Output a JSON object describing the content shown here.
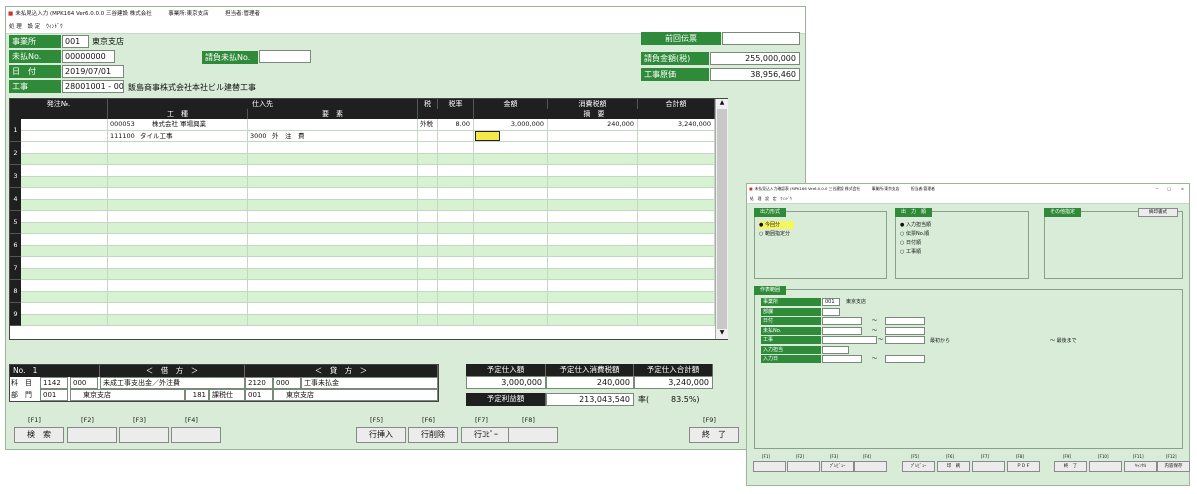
{
  "main": {
    "title": "未払見込入力 (MPK164 Ver6.0.0.0 三谷建設 株式会社　　　事業所:東京支店　　　担当者:管理者",
    "menu": [
      "処",
      "理",
      "設",
      "定",
      "ｳｨﾝﾄﾞｳ"
    ],
    "fields": {
      "jigyosho_label": "事業所",
      "jigyosho_code": "001",
      "jigyosho_name": "東京支店",
      "miharai_label": "未払No.",
      "miharai_value": "00000000",
      "date_label": "日　付",
      "date_value": "2019/07/01",
      "koji_label": "工事",
      "koji_code": "28001001 - 00",
      "koji_name": "飯島商事株式会社本社ビル建替工事",
      "ukeoi_label": "請負未払No.",
      "ukeoi_value": "",
      "zenkai_label": "前回伝票",
      "zenkai_value": "",
      "seiou_label": "請負金額(税)",
      "seiou_value": "255,000,000",
      "genka_label": "工事原価",
      "genka_value": "38,956,460"
    },
    "grid": {
      "head1": [
        "発注№.",
        "仕入先",
        "税",
        "税率",
        "金額",
        "消費税額",
        "合計額"
      ],
      "head2": [
        "工　種",
        "要　素",
        "摘　要"
      ],
      "row1": {
        "vendor_code": "000053",
        "vendor_name": "株式会社 軍場興業",
        "tax": "外税",
        "rate": "8.00",
        "amount": "3,000,000",
        "tax_amt": "240,000",
        "total": "3,240,000",
        "kind_code": "111100",
        "kind_name": "タイル工事",
        "elem_code": "3000",
        "elem_name": "外　注　費"
      },
      "row_numbers": [
        "1",
        "2",
        "3",
        "4",
        "5",
        "6",
        "7",
        "8",
        "9"
      ]
    },
    "journal": {
      "no_label": "No.",
      "no_value": "1",
      "debit_label": "＜　借　方　＞",
      "credit_label": "＜　貸　方　＞",
      "kamoku_label": "科　目",
      "bumon_label": "部　門",
      "debit_code": "1142",
      "debit_sub": "000",
      "debit_name": "未成工事支出金／外注費",
      "debit_dept_code": "001",
      "debit_dept_name": "東京支店",
      "tax_code": "181",
      "tax_name": "課税仕",
      "tax_dept_code": "001",
      "credit_code": "2120",
      "credit_sub": "000",
      "credit_name": "工事未払金",
      "credit_dept_name": "東京支店"
    },
    "summary": {
      "h1": "予定仕入額",
      "h2": "予定仕入消費税額",
      "h3": "予定仕入合計額",
      "v1": "3,000,000",
      "v2": "240,000",
      "v3": "3,240,000",
      "profit_label": "予定利益額",
      "profit_value": "213,043,540",
      "rate_label": "率(",
      "rate_value": "83.5%)"
    },
    "fkeys": [
      {
        "key": "[F1]",
        "label": "検　索"
      },
      {
        "key": "[F2]",
        "label": ""
      },
      {
        "key": "[F3]",
        "label": ""
      },
      {
        "key": "[F4]",
        "label": ""
      },
      {
        "key": "[F5]",
        "label": "行挿入"
      },
      {
        "key": "[F6]",
        "label": "行削除"
      },
      {
        "key": "[F7]",
        "label": "行ｺﾋﾟｰ"
      },
      {
        "key": "[F8]",
        "label": ""
      },
      {
        "key": "[F9]",
        "label": "終　了"
      }
    ]
  },
  "sub": {
    "title": "未払見込入力確認表 (MPK166 Ver6.0.0.0 三谷建設 株式会社　　　事業所:東京支店　　　担当者:管理者",
    "menu": "処　理　設　定　ｳｨﾝﾄﾞｳ",
    "window_controls": [
      "－",
      "□",
      "×"
    ],
    "output_format": {
      "title": "出力形式",
      "options": [
        "今回分",
        "範囲指定分"
      ]
    },
    "output_order": {
      "title": "出　力　順",
      "options": [
        "入力担当順",
        "伝票No.順",
        "日付順",
        "工事順"
      ]
    },
    "other": {
      "title": "その他指定",
      "button": "摘印書式"
    },
    "range": {
      "title": "作表範囲",
      "rows": [
        "事業所",
        "部課",
        "日付",
        "未払No.",
        "工事",
        "入力担当",
        "入力日"
      ],
      "jigyosho_code": "001",
      "jigyosho_name": "東京支店",
      "tilde": "～",
      "from_first": "最初から",
      "to_last": "～ 最後まで"
    },
    "fkeys": [
      {
        "key": "[F1]",
        "label": ""
      },
      {
        "key": "[F2]",
        "label": ""
      },
      {
        "key": "[F3]",
        "label": "ﾌﾟﾚﾋﾞｭｰ"
      },
      {
        "key": "[F4]",
        "label": ""
      },
      {
        "key": "[F5]",
        "label": "ﾌﾟﾚﾋﾞｭｰ"
      },
      {
        "key": "[F6]",
        "label": "印　刷"
      },
      {
        "key": "[F7]",
        "label": ""
      },
      {
        "key": "[F8]",
        "label": "ＰＤＦ"
      },
      {
        "key": "[F9]",
        "label": "終　了"
      },
      {
        "key": "[F10]",
        "label": ""
      },
      {
        "key": "[F11]",
        "label": "ｷｬﾝｾﾙ"
      },
      {
        "key": "[F12]",
        "label": "内容保存"
      }
    ]
  }
}
